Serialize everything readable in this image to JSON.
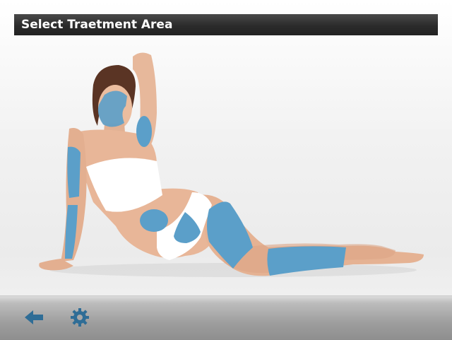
{
  "header": {
    "title": "Select Traetment Area"
  },
  "model": {
    "treatment_zones": [
      "face",
      "underarm",
      "upper-arm",
      "forearm",
      "abdomen",
      "bikini",
      "thigh",
      "lower-leg"
    ]
  },
  "colors": {
    "zone": "#5b9fc9",
    "header_bg": "#333333",
    "footer_icon": "#2f6d96"
  },
  "footer": {
    "back_icon": "arrow-left-icon",
    "settings_icon": "gear-icon"
  }
}
